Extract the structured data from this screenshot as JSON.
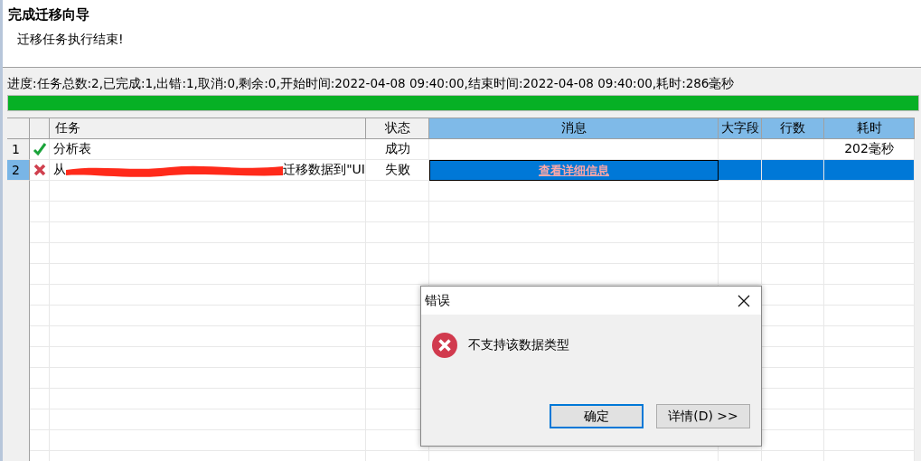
{
  "wizard": {
    "title": "完成迁移向导",
    "subtitle": "迁移任务执行结束!"
  },
  "progress": {
    "text": "进度:任务总数:2,已完成:1,出错:1,取消:0,剩余:0,开始时间:2022-04-08 09:40:00,结束时间:2022-04-08 09:40:00,耗时:286毫秒",
    "level": 1
  },
  "table": {
    "columns": [
      {
        "label": "任务",
        "selected": false
      },
      {
        "label": "状态",
        "selected": false
      },
      {
        "label": "消息",
        "selected": true
      },
      {
        "label": "大字段",
        "selected": true
      },
      {
        "label": "行数",
        "selected": true
      },
      {
        "label": "耗时",
        "selected": true
      }
    ],
    "rows": [
      {
        "number": "1",
        "kind": "success",
        "task": "分析表",
        "status": "成功",
        "duration": "202毫秒",
        "selected": false
      },
      {
        "number": "2",
        "kind": "error",
        "task": "从",
        "redacted": true,
        "task_tail": "迁移数据到\"UI",
        "status": "失败",
        "message_link": "查看详细信息",
        "selected": true
      }
    ]
  },
  "dialog": {
    "title": "错误",
    "message": "不支持该数据类型",
    "buttons": [
      {
        "label": "确定",
        "focused": true
      },
      {
        "label": "详情(D) >>",
        "focused": false
      }
    ]
  }
}
